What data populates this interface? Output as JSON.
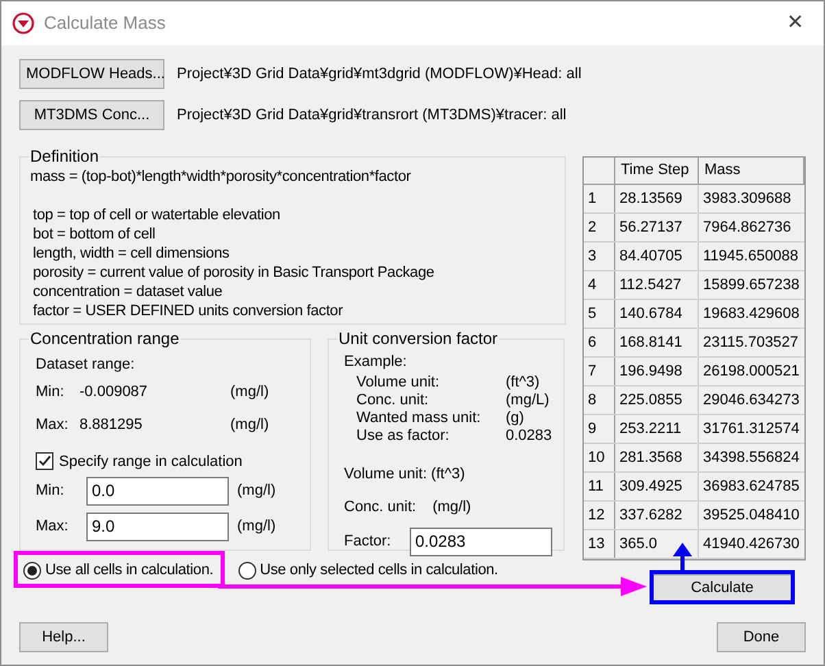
{
  "window": {
    "title": "Calculate Mass",
    "close": "✕"
  },
  "sources": [
    {
      "button": "MODFLOW Heads...",
      "path": "Project¥3D Grid Data¥grid¥mt3dgrid (MODFLOW)¥Head: all"
    },
    {
      "button": "MT3DMS Conc...",
      "path": "Project¥3D Grid Data¥grid¥transrort (MT3DMS)¥tracer: all"
    }
  ],
  "definition": {
    "title": "Definition",
    "formula": "mass = (top-bot)*length*width*porosity*concentration*factor",
    "lines": [
      "top = top of cell or watertable elevation",
      "bot = bottom of cell",
      "length, width = cell dimensions",
      "porosity = current value of porosity in Basic Transport Package",
      "concentration = dataset value",
      "factor = USER DEFINED units conversion factor"
    ]
  },
  "concentration_range": {
    "title": "Concentration range",
    "dataset_label": "Dataset range:",
    "dataset": [
      {
        "label": "Min:",
        "value": "-0.009087",
        "unit": "(mg/l)"
      },
      {
        "label": "Max:",
        "value": "8.881295",
        "unit": "(mg/l)"
      }
    ],
    "specify": {
      "label": "Specify range in calculation",
      "checked": true
    },
    "fields": [
      {
        "label": "Min:",
        "value": "0.0",
        "unit": "(mg/l)"
      },
      {
        "label": "Max:",
        "value": "9.0",
        "unit": "(mg/l)"
      }
    ]
  },
  "unit_conversion": {
    "title": "Unit conversion factor",
    "example_label": "Example:",
    "example": [
      {
        "label": "Volume unit:",
        "value": "(ft^3)"
      },
      {
        "label": "Conc. unit:",
        "value": "(mg/L)"
      },
      {
        "label": "Wanted mass unit:",
        "value": "(g)"
      },
      {
        "label": "Use as factor:",
        "value": "0.0283"
      }
    ],
    "volume": {
      "label": "Volume unit:",
      "value": "(ft^3)"
    },
    "conc": {
      "label": "Conc. unit:",
      "value": "(mg/l)"
    },
    "factor": {
      "label": "Factor:",
      "value": "0.0283"
    }
  },
  "cell_options": [
    {
      "label": "Use all cells in calculation.",
      "selected": true
    },
    {
      "label": "Use only selected cells in calculation.",
      "selected": false
    }
  ],
  "table": {
    "columns": [
      "Time Step",
      "Mass"
    ],
    "rows": [
      {
        "index": "1",
        "time_step": "28.13569",
        "mass": "3983.309688"
      },
      {
        "index": "2",
        "time_step": "56.27137",
        "mass": "7964.862736"
      },
      {
        "index": "3",
        "time_step": "84.40705",
        "mass": "11945.650088"
      },
      {
        "index": "4",
        "time_step": "112.5427",
        "mass": "15899.657238"
      },
      {
        "index": "5",
        "time_step": "140.6784",
        "mass": "19683.429608"
      },
      {
        "index": "6",
        "time_step": "168.8141",
        "mass": "23115.703527"
      },
      {
        "index": "7",
        "time_step": "196.9498",
        "mass": "26198.000521"
      },
      {
        "index": "8",
        "time_step": "225.0855",
        "mass": "29046.634273"
      },
      {
        "index": "9",
        "time_step": "253.2211",
        "mass": "31761.312574"
      },
      {
        "index": "10",
        "time_step": "281.3568",
        "mass": "34398.556824"
      },
      {
        "index": "11",
        "time_step": "309.4925",
        "mass": "36983.624785"
      },
      {
        "index": "12",
        "time_step": "337.6282",
        "mass": "39525.048410"
      },
      {
        "index": "13",
        "time_step": "365.0",
        "mass": "41940.426730"
      }
    ]
  },
  "calculate_button": "Calculate",
  "buttons": [
    "Help...",
    "Done"
  ]
}
